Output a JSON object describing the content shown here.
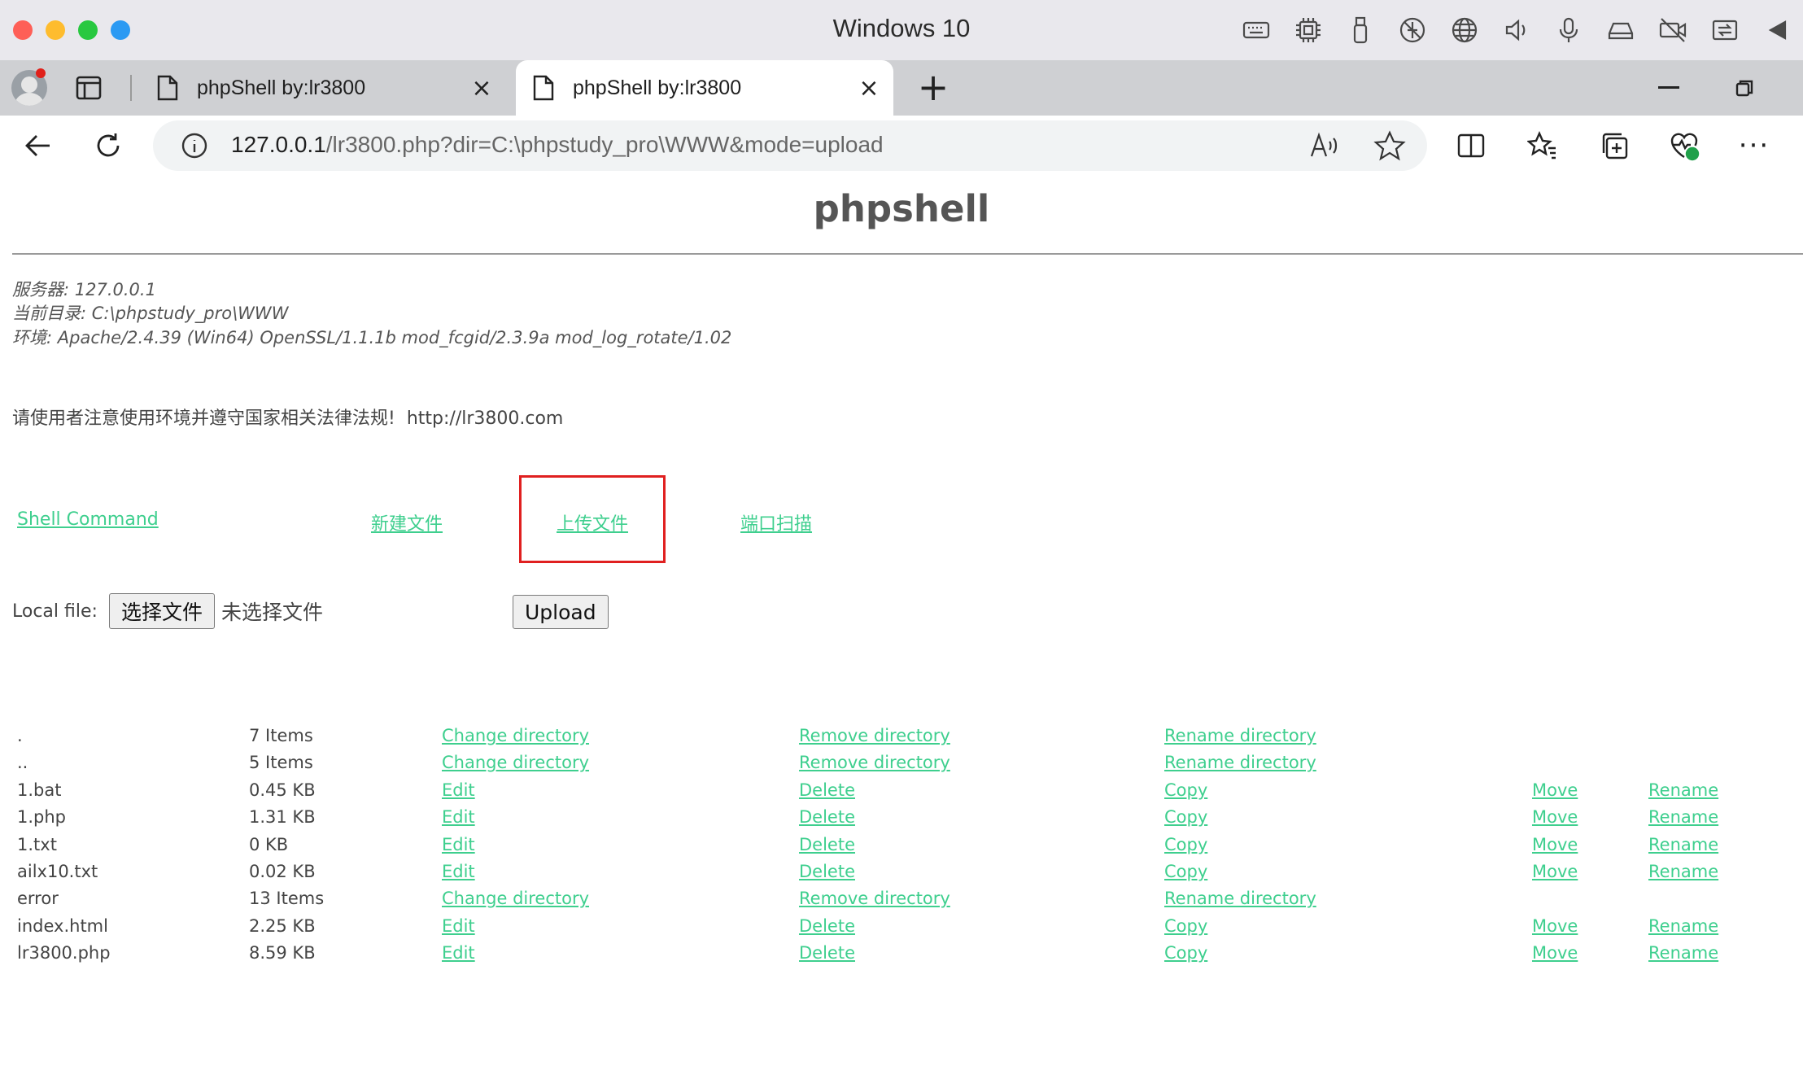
{
  "mac": {
    "title": "Windows 10",
    "status_icons": [
      "keyboard-icon",
      "cpu-icon",
      "usb-icon",
      "network-off-icon",
      "globe-icon",
      "speaker-icon",
      "microphone-icon",
      "drive-icon",
      "camera-off-icon",
      "shared-folder-icon",
      "collapse-arrow-icon"
    ]
  },
  "browser": {
    "tabs": [
      {
        "title": "phpShell by:lr3800",
        "close": "×"
      },
      {
        "title": "phpShell by:lr3800",
        "close": "×"
      }
    ],
    "new_tab": "+",
    "url_host": "127.0.0.1",
    "url_rest": "/lr3800.php?dir=C:\\phpstudy_pro\\WWW&mode=upload",
    "more": "···"
  },
  "page": {
    "heading": "phpshell",
    "server": "服务器: 127.0.0.1",
    "current_dir": "当前目录: C:\\phpstudy_pro\\WWW",
    "environment": "环境: Apache/2.4.39 (Win64) OpenSSL/1.1.1b mod_fcgid/2.3.9a mod_log_rotate/1.02",
    "notice": "请使用者注意使用环境并遵守国家相关法律法规!",
    "site": "http://lr3800.com",
    "nav": {
      "shell_command": "Shell Command",
      "new_file": "新建文件",
      "upload_file": "上传文件",
      "port_scan": "端口扫描"
    },
    "upload": {
      "label": "Local file:",
      "choose_button": "选择文件",
      "no_file": "未选择文件",
      "upload_button": "Upload"
    },
    "accent_color": "#3ecf8e",
    "highlight_color": "#e02020"
  },
  "files": [
    {
      "name": ".",
      "size": "7 Items",
      "a1": "Change directory",
      "a2": "Remove directory",
      "a3": "Rename directory",
      "a4": "",
      "a5": ""
    },
    {
      "name": "..",
      "size": "5 Items",
      "a1": "Change directory",
      "a2": "Remove directory",
      "a3": "Rename directory",
      "a4": "",
      "a5": ""
    },
    {
      "name": "1.bat",
      "size": "0.45 KB",
      "a1": "Edit",
      "a2": "Delete",
      "a3": "Copy",
      "a4": "Move",
      "a5": "Rename"
    },
    {
      "name": "1.php",
      "size": "1.31 KB",
      "a1": "Edit",
      "a2": "Delete",
      "a3": "Copy",
      "a4": "Move",
      "a5": "Rename"
    },
    {
      "name": "1.txt",
      "size": "0 KB",
      "a1": "Edit",
      "a2": "Delete",
      "a3": "Copy",
      "a4": "Move",
      "a5": "Rename"
    },
    {
      "name": "ailx10.txt",
      "size": "0.02 KB",
      "a1": "Edit",
      "a2": "Delete",
      "a3": "Copy",
      "a4": "Move",
      "a5": "Rename"
    },
    {
      "name": "error",
      "size": "13 Items",
      "a1": "Change directory",
      "a2": "Remove directory",
      "a3": "Rename directory",
      "a4": "",
      "a5": ""
    },
    {
      "name": "index.html",
      "size": "2.25 KB",
      "a1": "Edit",
      "a2": "Delete",
      "a3": "Copy",
      "a4": "Move",
      "a5": "Rename"
    },
    {
      "name": "lr3800.php",
      "size": "8.59 KB",
      "a1": "Edit",
      "a2": "Delete",
      "a3": "Copy",
      "a4": "Move",
      "a5": "Rename"
    }
  ]
}
